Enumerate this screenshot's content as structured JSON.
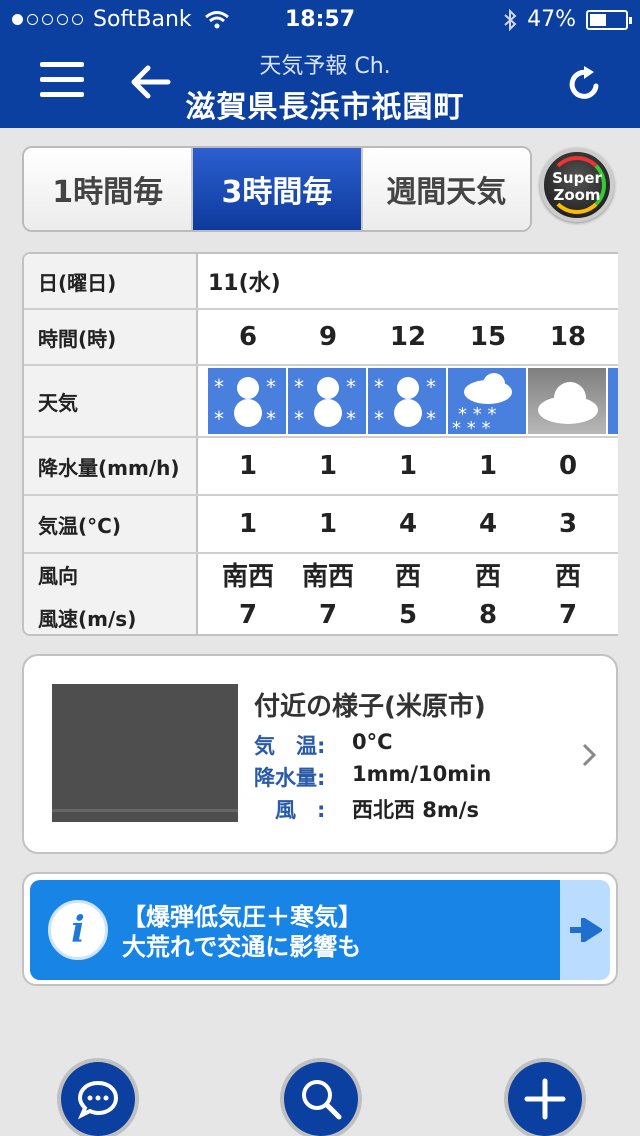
{
  "status": {
    "carrier": "SoftBank",
    "time": "18:57",
    "battery": "47%",
    "battery_level": 0.47
  },
  "header": {
    "subtitle": "天気予報 Ch.",
    "title": "滋賀県長浜市祇園町",
    "menu_icon": "menu-icon",
    "back_icon": "back-arrow-icon",
    "refresh_icon": "refresh-icon"
  },
  "tabs": [
    {
      "label": "1時間毎",
      "active": false
    },
    {
      "label": "3時間毎",
      "active": true
    },
    {
      "label": "週間天気",
      "active": false
    }
  ],
  "superzoom": {
    "line1": "Super",
    "line2": "Zoom"
  },
  "table": {
    "labels": {
      "date": "日(曜日)",
      "time": "時間(時)",
      "weather": "天気",
      "precip": "降水量(mm/h)",
      "temp": "気温(°C)",
      "wind_dir": "風向",
      "wind_speed": "風速(m/s)"
    },
    "date": "11(水)",
    "columns": [
      {
        "hour": "6",
        "weather": "snow",
        "precip": "1",
        "temp": "1",
        "dir": "南西",
        "speed": "7"
      },
      {
        "hour": "9",
        "weather": "snow",
        "precip": "1",
        "temp": "1",
        "dir": "南西",
        "speed": "7"
      },
      {
        "hour": "12",
        "weather": "snow",
        "precip": "1",
        "temp": "4",
        "dir": "西",
        "speed": "5"
      },
      {
        "hour": "15",
        "weather": "cloud-snow",
        "precip": "1",
        "temp": "4",
        "dir": "西",
        "speed": "8"
      },
      {
        "hour": "18",
        "weather": "cloudy",
        "precip": "0",
        "temp": "3",
        "dir": "西",
        "speed": "7"
      }
    ]
  },
  "nearby": {
    "title": "付近の様子(米原市)",
    "rows": [
      {
        "key": "気　温:",
        "value": "0°C"
      },
      {
        "key": "降水量:",
        "value": "1mm/10min"
      },
      {
        "key": "　風　:",
        "value": "西北西 8m/s"
      }
    ]
  },
  "news": {
    "line1": "【爆弾低気圧＋寒気】",
    "line2": "大荒れで交通に影響も",
    "icon": "info-icon"
  },
  "bottom": [
    {
      "icon": "chat-icon"
    },
    {
      "icon": "search-icon"
    },
    {
      "icon": "plus-icon"
    }
  ]
}
